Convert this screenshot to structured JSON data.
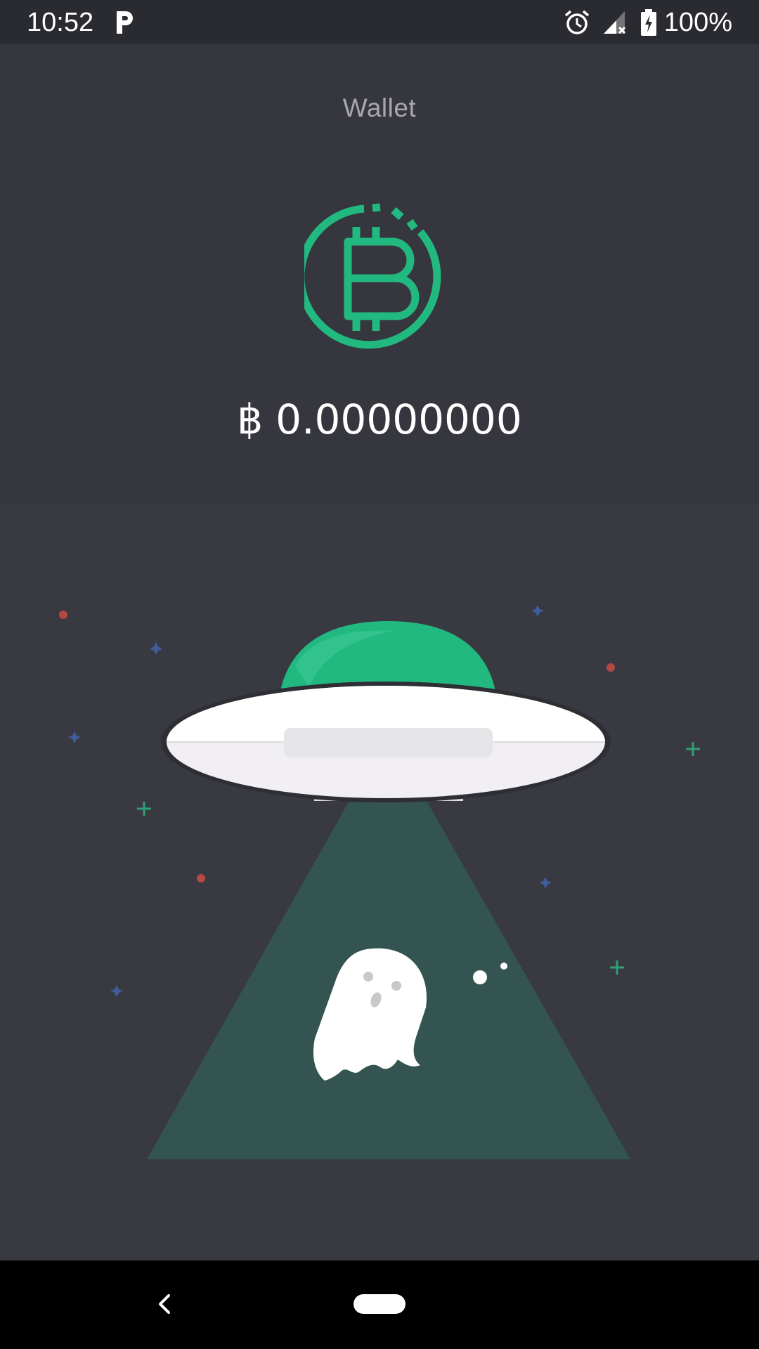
{
  "status_bar": {
    "time": "10:52",
    "battery": "100%",
    "icons": [
      "parking-icon",
      "alarm-icon",
      "signal-icon",
      "battery-charging-icon"
    ]
  },
  "header": {
    "title": "Wallet",
    "balance_symbol": "฿",
    "balance_amount": "0.00000000"
  },
  "colors": {
    "accent": "#22b980",
    "background": "#38383f",
    "header_background": "#35363e"
  },
  "illustration": {
    "icons": [
      "ufo-icon",
      "ghost-icon",
      "light-beam",
      "star-icon"
    ]
  },
  "nav_bar": {
    "icons": [
      "back-icon",
      "home-pill-icon"
    ]
  }
}
